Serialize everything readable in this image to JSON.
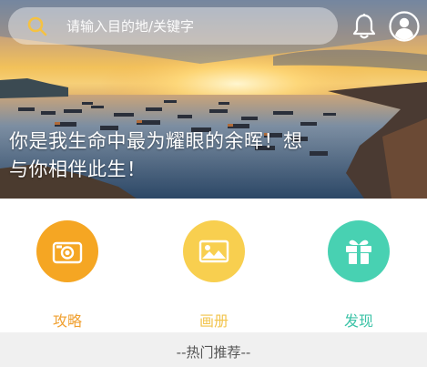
{
  "search": {
    "placeholder": "请输入目的地/关键字"
  },
  "hero": {
    "caption": "你是我生命中最为耀眼的余晖！想与你相伴此生！"
  },
  "menu": {
    "items": [
      {
        "label": "攻略",
        "icon": "camera-icon",
        "circle_color": "#F5A623",
        "label_color": "#F0A030"
      },
      {
        "label": "画册",
        "icon": "picture-icon",
        "circle_color": "#F8CF4F",
        "label_color": "#F2C44C"
      },
      {
        "label": "发现",
        "icon": "gift-icon",
        "circle_color": "#48D1B2",
        "label_color": "#3CC3A7"
      }
    ]
  },
  "section": {
    "title": "--热门推荐--"
  },
  "colors": {
    "search_icon": "#F5C242",
    "section_bg": "#F0F0F0"
  }
}
